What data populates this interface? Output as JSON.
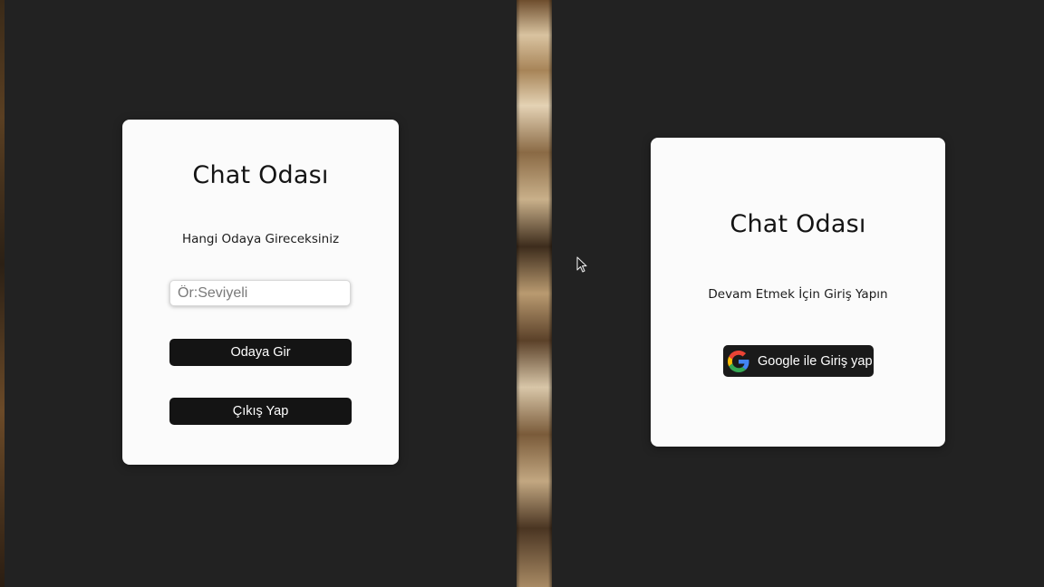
{
  "left_window": {
    "title": "Chat Odası",
    "subtitle": "Hangi Odaya Gireceksiniz",
    "room_input": {
      "value": "",
      "placeholder": "Ör:Seviyeli"
    },
    "enter_button_label": "Odaya Gir",
    "exit_button_label": "Çıkış Yap"
  },
  "right_window": {
    "title": "Chat Odası",
    "subtitle": "Devam Etmek İçin Giriş Yapın",
    "google_button_label": "Google ile Giriş yap",
    "google_icon": "google-g-icon"
  },
  "colors": {
    "background": "#222222",
    "card": "#fbfbfb",
    "button": "#141414",
    "button_text": "#ffffff",
    "google_blue": "#4285F4",
    "google_red": "#EA4335",
    "google_yellow": "#FBBC05",
    "google_green": "#34A853"
  }
}
